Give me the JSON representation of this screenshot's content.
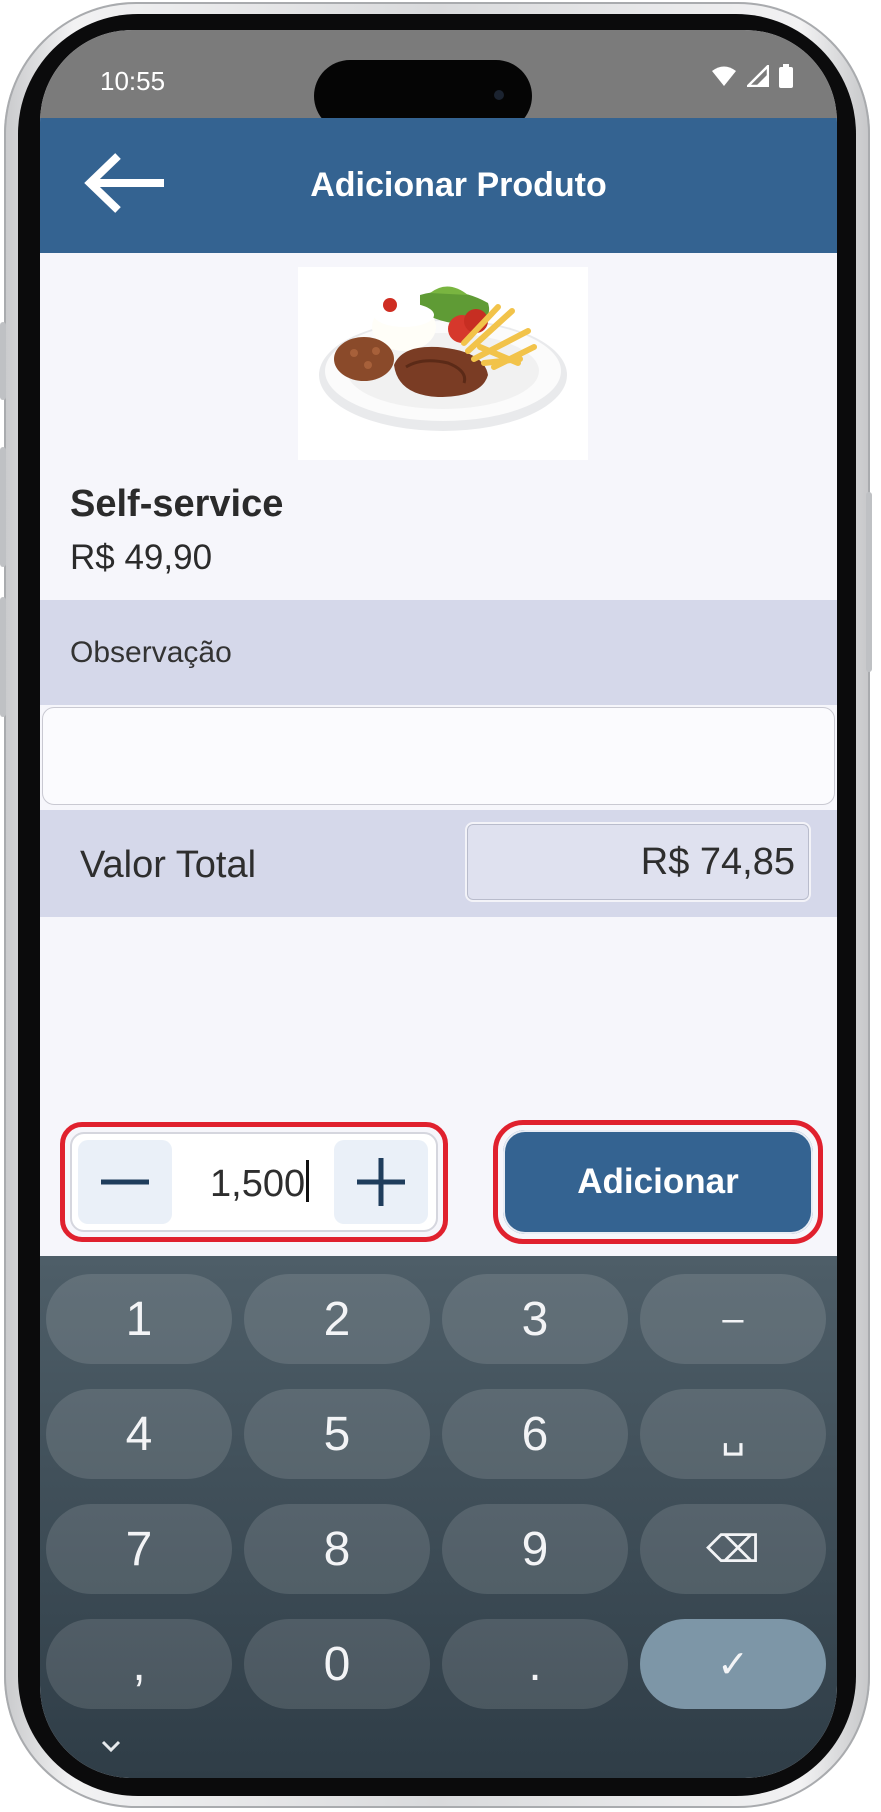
{
  "status_bar": {
    "time": "10:55",
    "icons": [
      "wifi-icon",
      "signal-icon",
      "battery-icon"
    ]
  },
  "app_bar": {
    "title": "Adicionar Produto",
    "back_icon": "arrow-left-icon"
  },
  "product": {
    "name": "Self-service",
    "price": "R$ 49,90",
    "image": "plate-of-food"
  },
  "observation": {
    "label": "Observação",
    "value": "",
    "placeholder": ""
  },
  "total": {
    "label": "Valor Total",
    "value": "R$ 74,85"
  },
  "quantity": {
    "value": "1,500",
    "decrease_icon": "minus-icon",
    "increase_icon": "plus-icon"
  },
  "add_button": {
    "label": "Adicionar"
  },
  "keyboard": {
    "rows": [
      [
        "1",
        "2",
        "3",
        "–"
      ],
      [
        "4",
        "5",
        "6",
        "␣"
      ],
      [
        "7",
        "8",
        "9",
        "⌫"
      ],
      [
        ",",
        "0",
        ".",
        "✓"
      ]
    ],
    "hide_icon": "chevron-down-icon"
  },
  "colors": {
    "primary": "#346391",
    "band": "#d5d8ea",
    "highlight": "#e0212e"
  }
}
